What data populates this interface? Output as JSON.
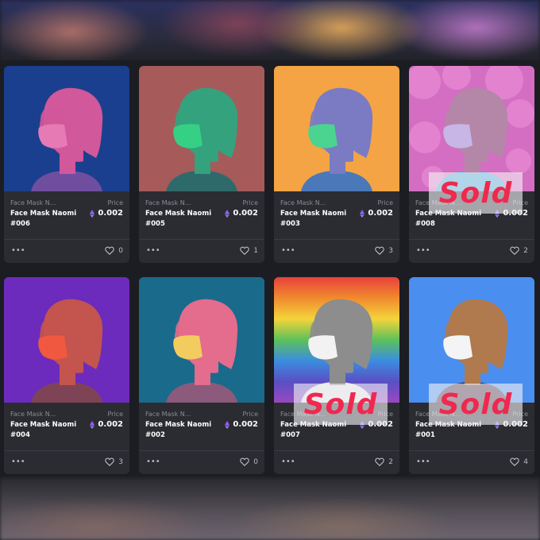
{
  "cards": [
    {
      "collection": "Face Mask N...",
      "price_label": "Price",
      "name": "Face Mask Naomi #006",
      "price": "0.002",
      "likes": "0",
      "sold": false,
      "bg": "#1b3f8f",
      "figure": "#d1589a",
      "mask": "#e67ab5",
      "shirt": "#6f4ea0"
    },
    {
      "collection": "Face Mask N...",
      "price_label": "Price",
      "name": "Face Mask Naomi #005",
      "price": "0.002",
      "likes": "1",
      "sold": false,
      "bg": "#a65a5a",
      "figure": "#34a27d",
      "mask": "#35d084",
      "shirt": "#2f6a6a"
    },
    {
      "collection": "Face Mask N...",
      "price_label": "Price",
      "name": "Face Mask Naomi #003",
      "price": "0.002",
      "likes": "3",
      "sold": false,
      "bg": "#f4a444",
      "figure": "#7a7bc2",
      "mask": "#4bd48f",
      "shirt": "#4a78b8"
    },
    {
      "collection": "Face Mask N...",
      "price_label": "Price",
      "name": "Face Mask Naomi #008",
      "price": "0.002",
      "likes": "2",
      "sold": true,
      "sold_text": "Sold",
      "bg": "#d46ec2",
      "figure": "#b487a8",
      "mask": "#c7b6e6",
      "shirt": "#4aa9d8"
    },
    {
      "collection": "Face Mask N...",
      "price_label": "Price",
      "name": "Face Mask Naomi #004",
      "price": "0.002",
      "likes": "3",
      "sold": false,
      "bg": "#6c2bbd",
      "figure": "#c4544e",
      "mask": "#f0583f",
      "shirt": "#7e4455"
    },
    {
      "collection": "Face Mask N...",
      "price_label": "Price",
      "name": "Face Mask Naomi #002",
      "price": "0.002",
      "likes": "0",
      "sold": false,
      "bg": "#1a6a8c",
      "figure": "#e46c8c",
      "mask": "#f2cc5e",
      "shirt": "#8c5a7a"
    },
    {
      "collection": "Face Mask N...",
      "price_label": "Price",
      "name": "Face Mask Naomi #007",
      "price": "0.002",
      "likes": "2",
      "sold": true,
      "sold_text": "Sold",
      "bg": "rainbow",
      "figure": "#8d8d8d",
      "mask": "#f2f2f2",
      "shirt": "#e8e8e8"
    },
    {
      "collection": "Face Mask N...",
      "price_label": "Price",
      "name": "Face Mask Naomi #001",
      "price": "0.002",
      "likes": "4",
      "sold": true,
      "sold_text": "Sold",
      "bg": "#4a8ef0",
      "figure": "#b07a4e",
      "mask": "#f4f4f4",
      "shirt": "#4a2a40"
    }
  ],
  "colors": {
    "sold_text": "#f0284f",
    "eth_icon": "#8b5cf6"
  }
}
